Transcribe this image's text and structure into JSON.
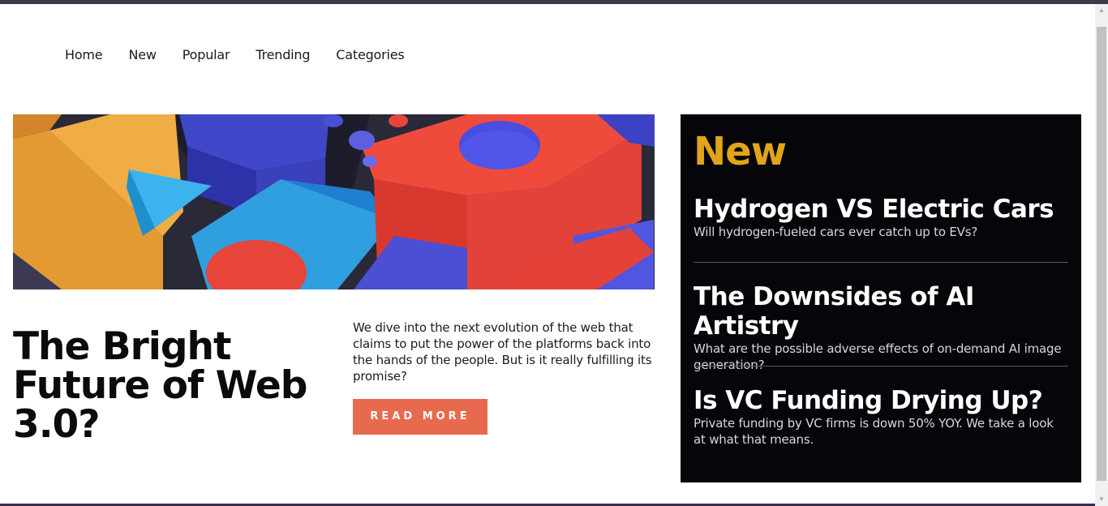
{
  "nav": {
    "items": [
      "Home",
      "New",
      "Popular",
      "Trending",
      "Categories"
    ]
  },
  "hero": {
    "title": "The Bright Future of Web 3.0?",
    "description": "We dive into the next evolution of the web that claims to put the power of the platforms back into the hands of the people. But is it really fulfilling its promise?",
    "button_label": "READ MORE",
    "image_alt": "abstract-3d-geometric-shapes"
  },
  "new_panel": {
    "heading": "New",
    "items": [
      {
        "title": "Hydrogen VS Electric Cars",
        "summary": "Will hydrogen-fueled cars ever catch up to EVs?"
      },
      {
        "title": "The Downsides of AI Artistry",
        "summary": "What are the possible adverse effects of on-demand AI image generation?"
      },
      {
        "title": "Is VC Funding Drying Up?",
        "summary": "Private funding by VC firms is down 50% YOY. We take a look at what that means."
      }
    ]
  },
  "colors": {
    "accent_orange": "#e76a4f",
    "gold": "#e2a418",
    "panel_bg": "#060509"
  }
}
